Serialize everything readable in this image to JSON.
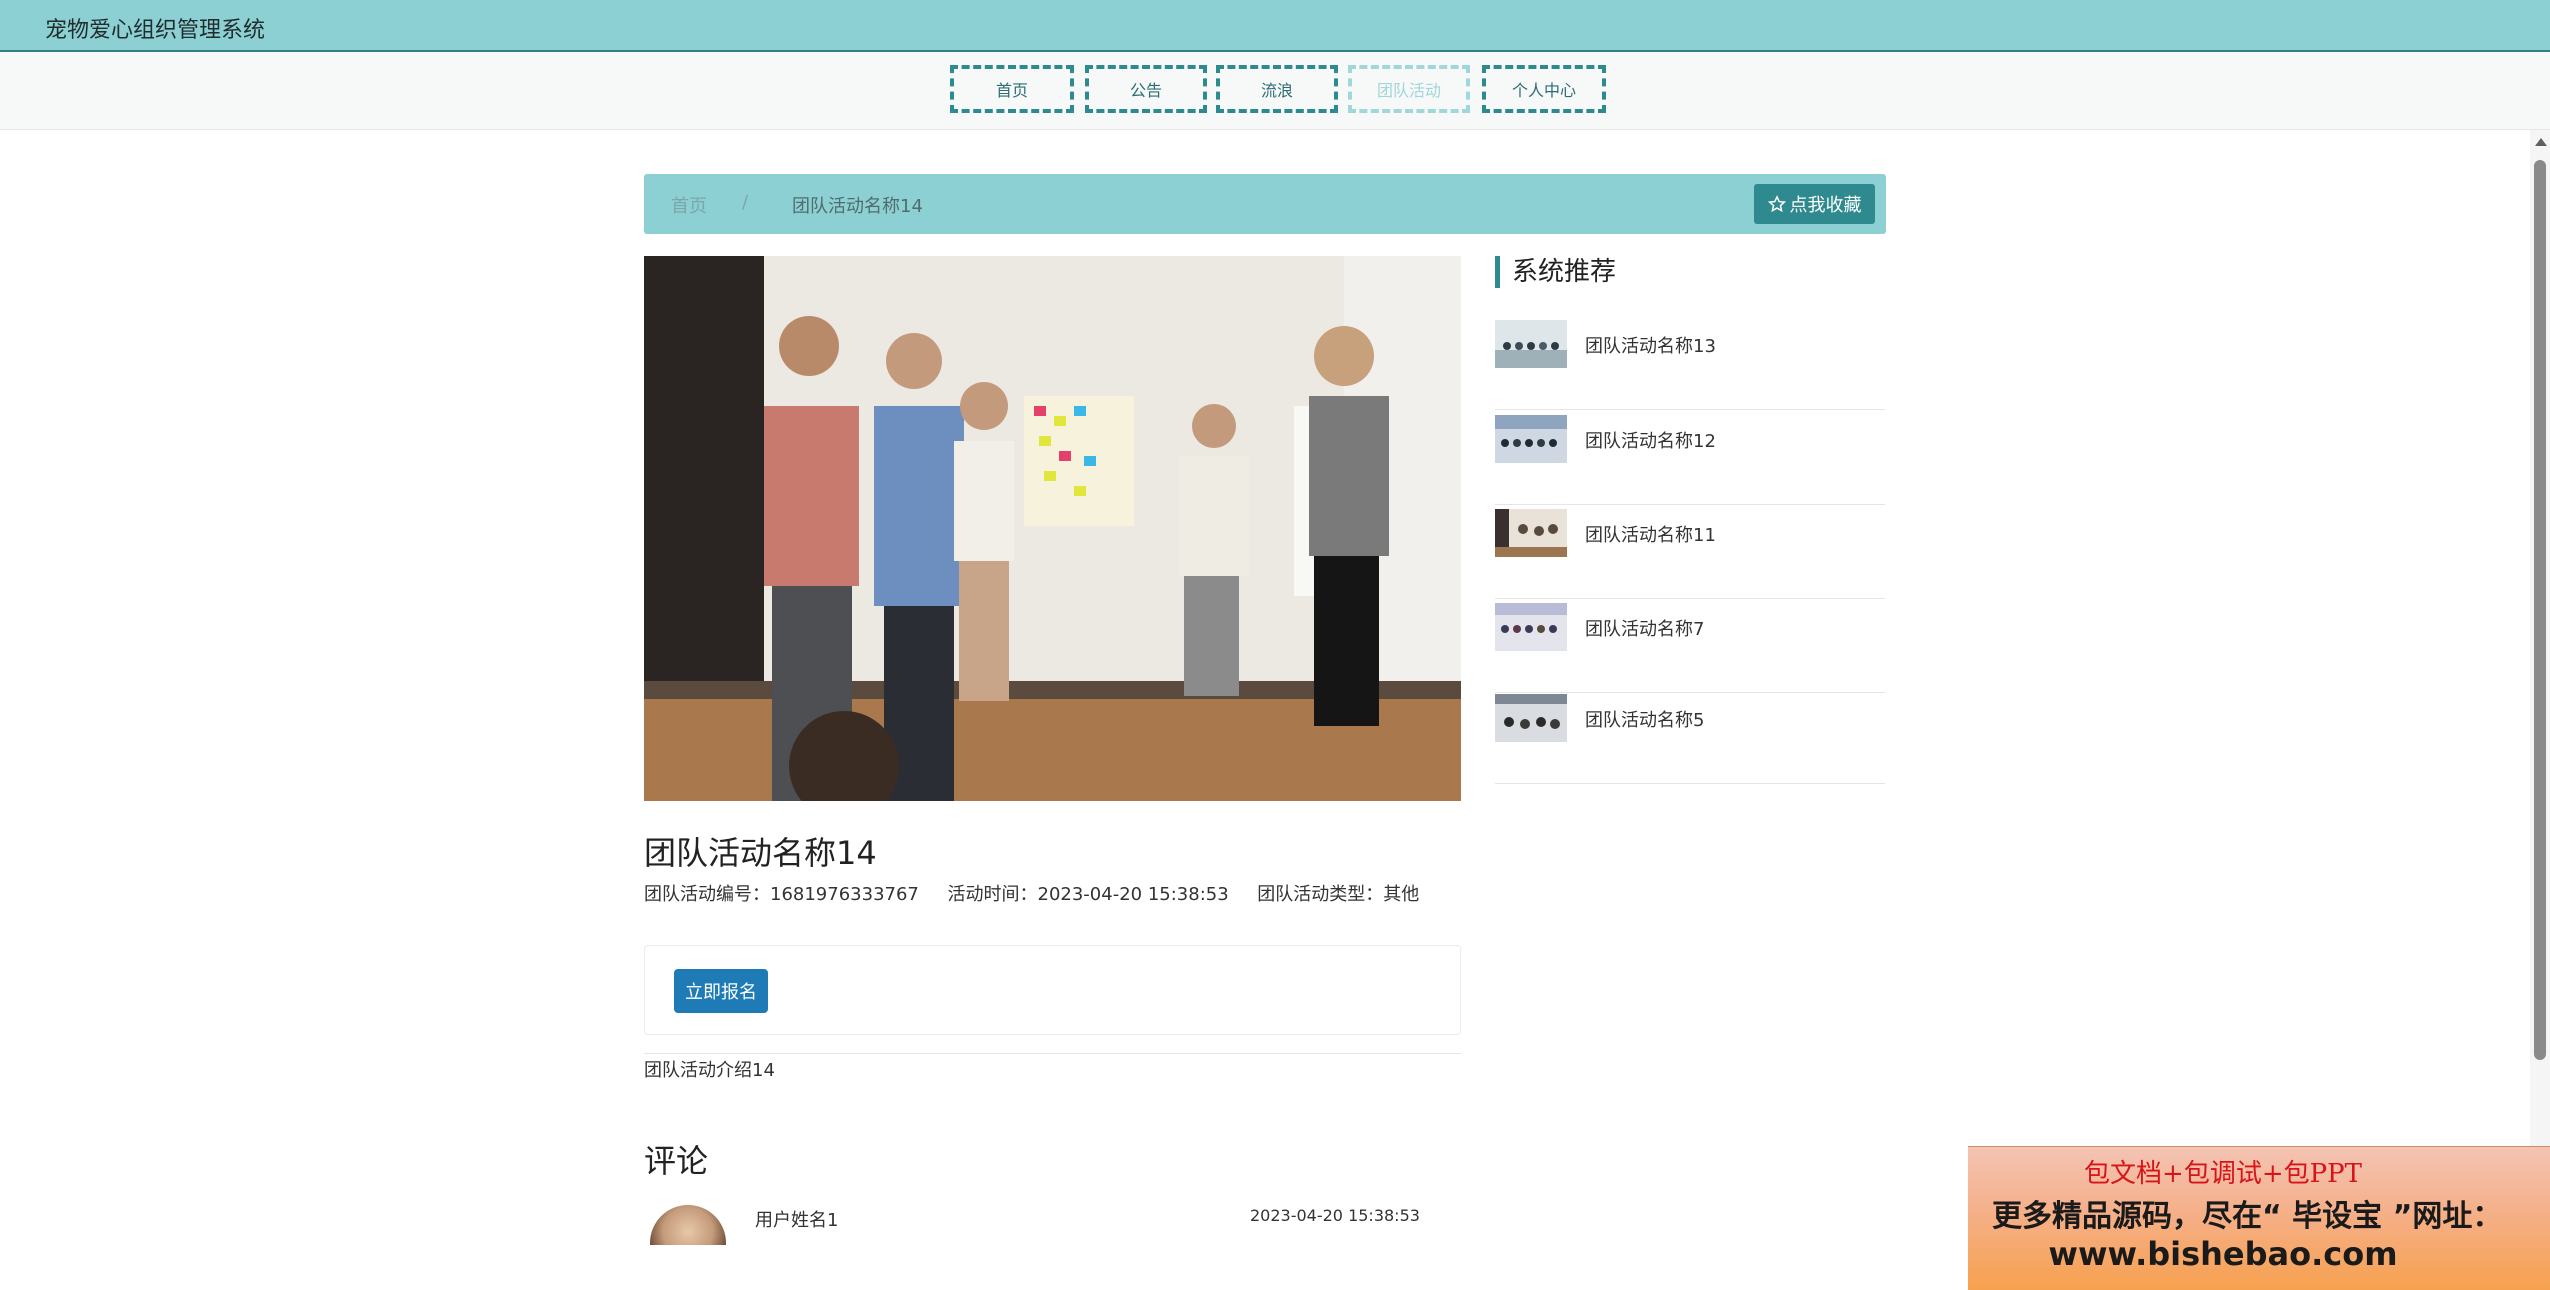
{
  "header": {
    "title": "宠物爱心组织管理系统"
  },
  "nav": {
    "home": "首页",
    "notice": "公告",
    "stray": "流浪",
    "team_activity": "团队活动",
    "user_center": "个人中心"
  },
  "breadcrumb": {
    "home": "首页",
    "separator": "/",
    "current": "团队活动名称14",
    "favorite_icon": "star-outline-icon",
    "favorite_label": "点我收藏"
  },
  "detail": {
    "title": "团队活动名称14",
    "code_label": "团队活动编号：",
    "code_value": "1681976333767",
    "time_label": "活动时间：",
    "time_value": "2023-04-20 15:38:53",
    "type_label": "团队活动类型：",
    "type_value": "其他",
    "signup_label": "立即报名",
    "intro": "团队活动介绍14"
  },
  "comments": {
    "heading": "评论",
    "items": [
      {
        "user": "用户姓名1",
        "time": "2023-04-20 15:38:53"
      }
    ]
  },
  "sidebar": {
    "heading": "系统推荐",
    "items": [
      {
        "label": "团队活动名称13"
      },
      {
        "label": "团队活动名称12"
      },
      {
        "label": "团队活动名称11"
      },
      {
        "label": "团队活动名称7"
      },
      {
        "label": "团队活动名称5"
      }
    ]
  },
  "ad": {
    "line1": "包文档+包调试+包PPT",
    "line2": "更多精品源码，尽在“ 毕设宝 ”网址：",
    "line3": "www.bishebao.com"
  },
  "colors": {
    "accent": "#8dd0d3",
    "button_teal": "#2e8a8f",
    "signup_blue": "#1f7bb5"
  }
}
